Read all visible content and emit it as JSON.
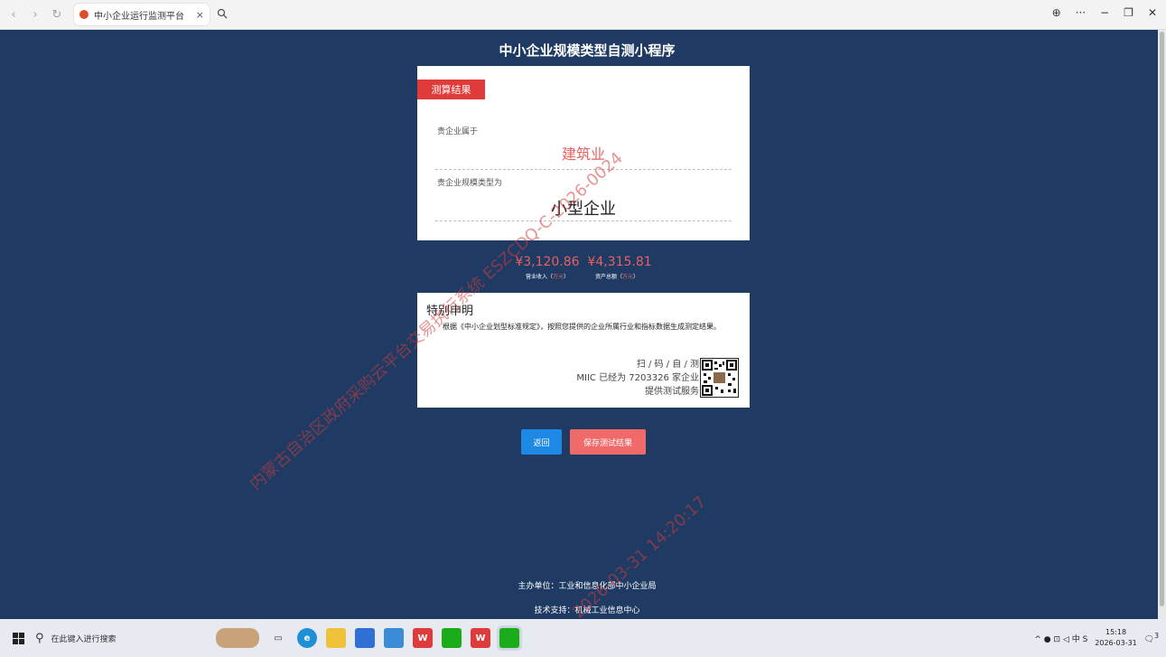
{
  "browser": {
    "tab_title": "中小企业运行监测平台",
    "tab_close": "×",
    "back": "‹",
    "forward": "›",
    "refresh": "↻",
    "search_tab_icon": "search-icon",
    "window_controls": [
      "⊕",
      "···",
      "−",
      "❐",
      "✕"
    ]
  },
  "page": {
    "title": "中小企业规模类型自测小程序",
    "result_ribbon": "测算结果",
    "belongs_label": "贵企业属于",
    "industry": "建筑业",
    "size_label": "贵企业规模类型为",
    "size_type": "小型企业",
    "revenue_value": "¥3,120.86",
    "revenue_label": "营业收入",
    "revenue_unit": "万元",
    "assets_value": "¥4,315.81",
    "assets_label": "资产总额",
    "assets_unit": "万元",
    "declaration_title": "特别申明",
    "declaration_body": "根据《中小企业划型标准规定》，按照您提供的企业所属行业和指标数据生成测定结果。",
    "scan_line1": "扫 / 码 / 自 / 测",
    "scan_line2": "MIIC 已经为 7203326 家企业",
    "scan_line3": "提供测试服务",
    "back_button": "返回",
    "save_button": "保存测试结果",
    "footer_sponsor": "主办单位：工业和信息化部中小企业局",
    "footer_support": "技术支持：机械工业信息中心"
  },
  "watermark": {
    "text1": "内蒙古自治区政府采购云平台交易执行系统 ESZCDQ-C-2026-0024",
    "text2": "2026-03-31 14:20:17"
  },
  "taskbar": {
    "search_placeholder": "在此键入进行搜索",
    "tray_icons": "^ ● ⊡ ◁ 中 S",
    "time": "15:18",
    "date": "2026-03-31",
    "notification_count": "3"
  }
}
